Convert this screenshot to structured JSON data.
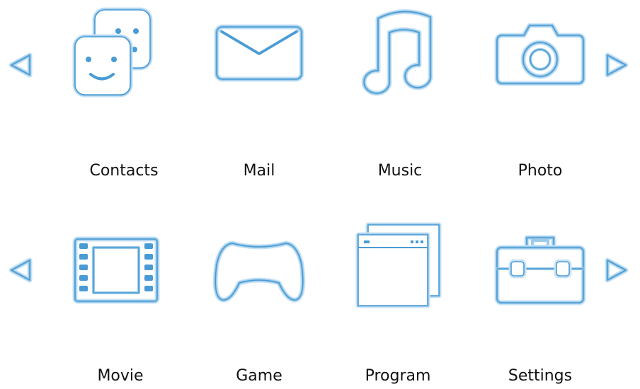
{
  "accent_color": "#4a9bd4",
  "rows": [
    {
      "items": [
        {
          "label": "Contacts",
          "icon": "contacts-icon"
        },
        {
          "label": "Mail",
          "icon": "mail-icon"
        },
        {
          "label": "Music",
          "icon": "music-icon"
        },
        {
          "label": "Photo",
          "icon": "camera-icon"
        }
      ],
      "prev_arrow": "triangle-left-icon",
      "next_arrow": "triangle-right-icon"
    },
    {
      "items": [
        {
          "label": "Movie",
          "icon": "film-icon"
        },
        {
          "label": "Game",
          "icon": "gamepad-icon"
        },
        {
          "label": "Program",
          "icon": "window-icon"
        },
        {
          "label": "Settings",
          "icon": "toolbox-icon"
        }
      ],
      "prev_arrow": "triangle-left-icon",
      "next_arrow": "triangle-right-icon"
    }
  ]
}
